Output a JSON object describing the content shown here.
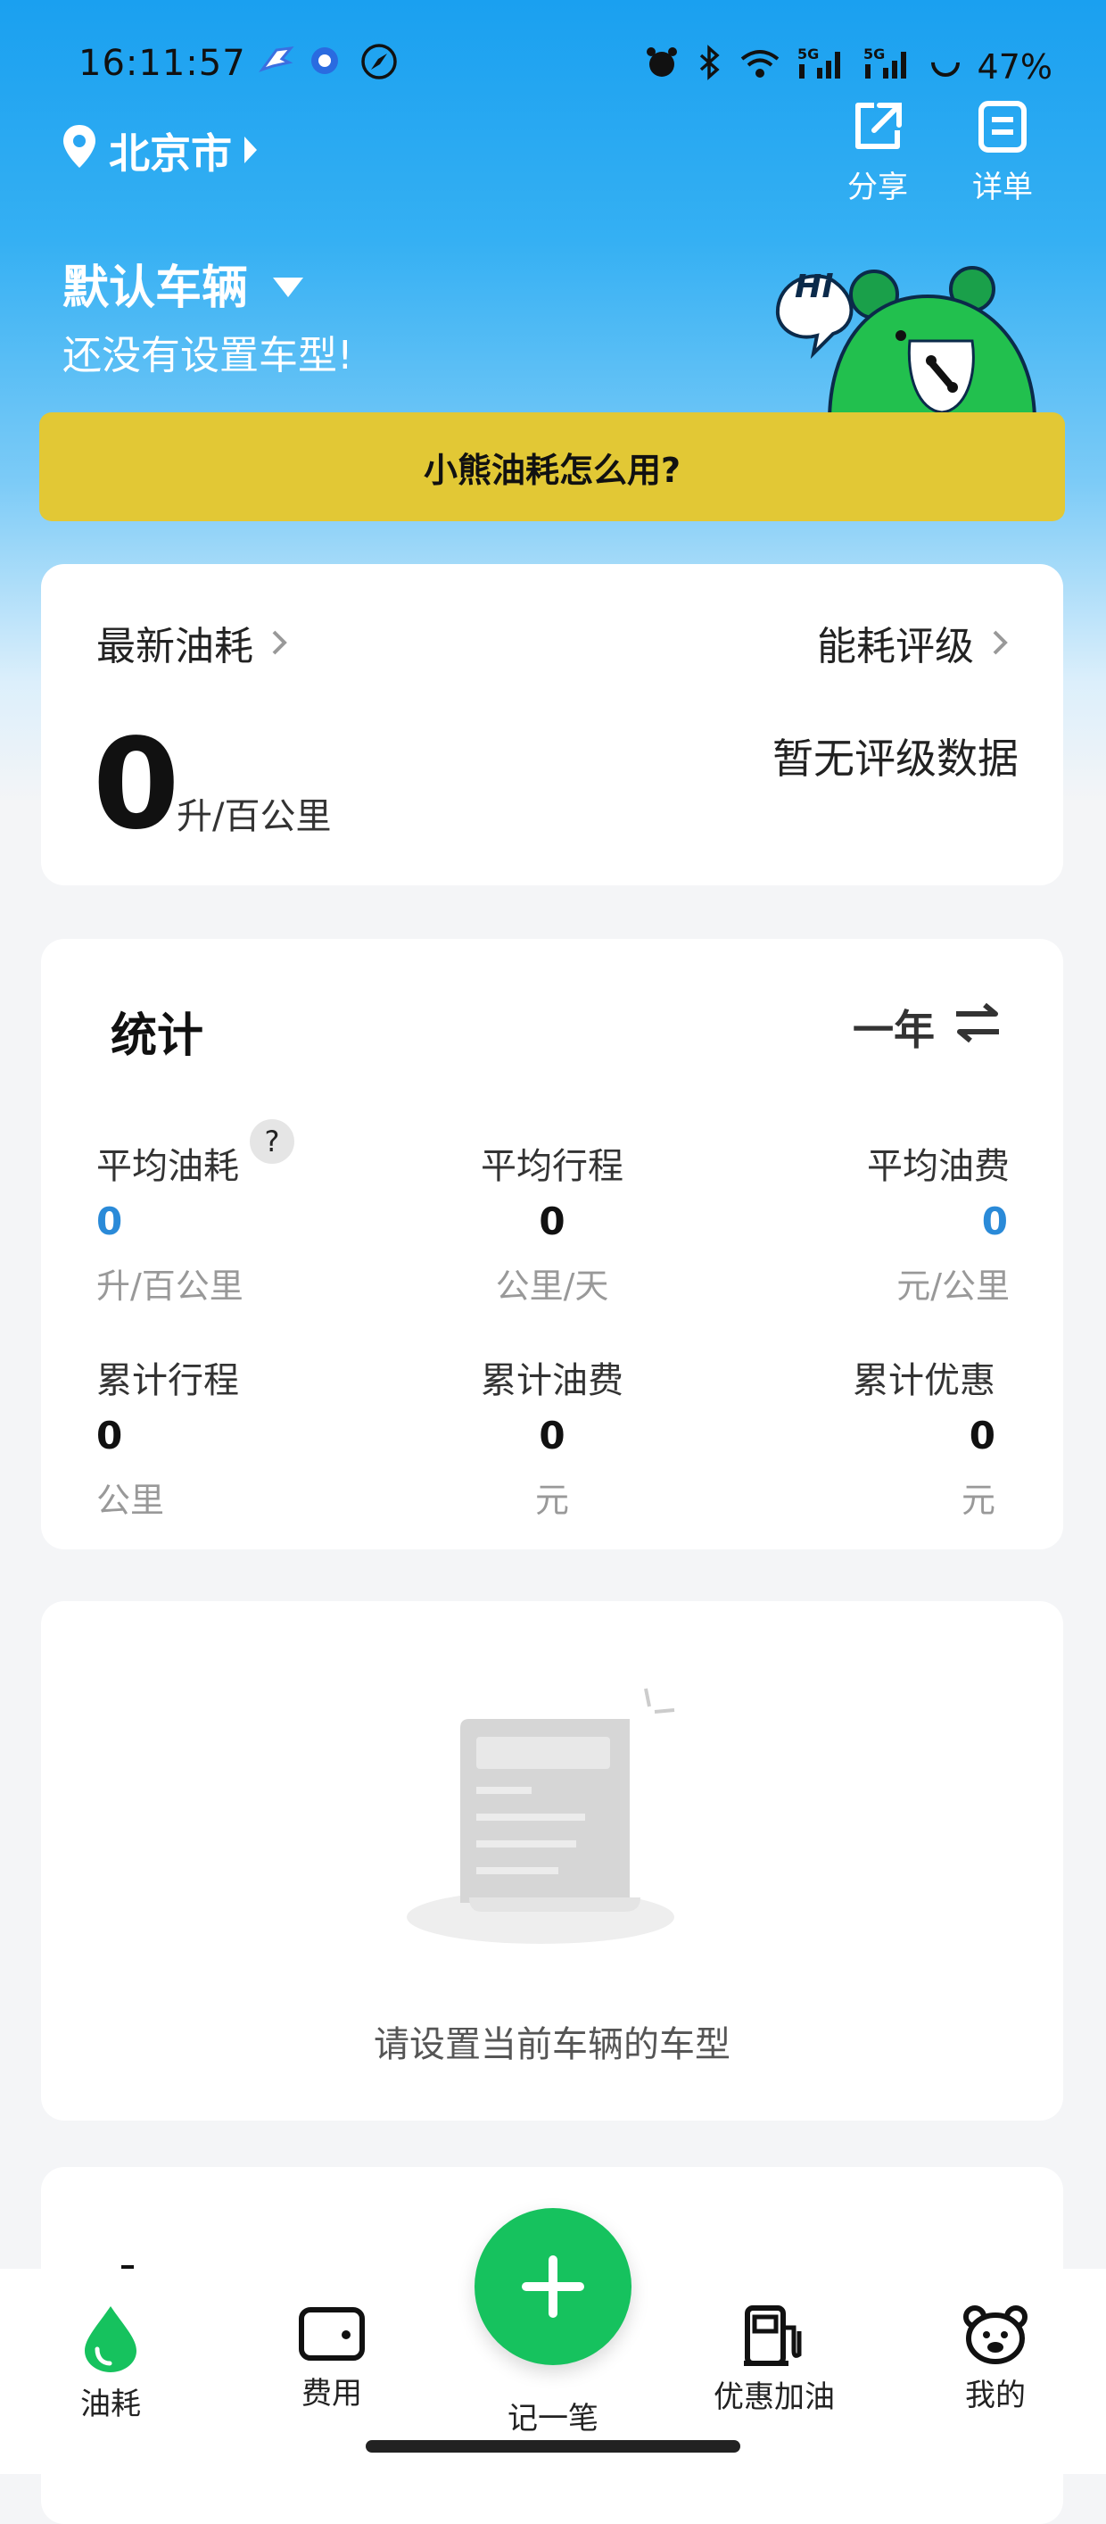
{
  "status_bar": {
    "time": "16:11:57",
    "battery": "47%",
    "icons": [
      "bird-icon",
      "record-icon",
      "compass-icon",
      "alarm-icon",
      "bluetooth-icon",
      "wifi-icon",
      "signal-5g-icon",
      "signal-5g-icon",
      "battery-icon"
    ]
  },
  "header": {
    "city": "北京市",
    "share_label": "分享",
    "detail_label": "详单",
    "vehicle_name": "默认车辆",
    "vehicle_subtitle": "还没有设置车型!",
    "mascot_bubble": "Hi",
    "howto_label": "小熊油耗怎么用?"
  },
  "latest": {
    "latest_label": "最新油耗",
    "rating_label": "能耗评级",
    "value": "0",
    "unit": "升/百公里",
    "rating_value": "暂无评级数据"
  },
  "stats": {
    "title": "统计",
    "period": "一年",
    "items": [
      {
        "label": "平均油耗",
        "value": "0",
        "unit": "升/百公里"
      },
      {
        "label": "平均行程",
        "value": "0",
        "unit": "公里/天"
      },
      {
        "label": "平均油费",
        "value": "0",
        "unit": "元/公里"
      },
      {
        "label": "累计行程",
        "value": "0",
        "unit": "公里"
      },
      {
        "label": "累计油费",
        "value": "0",
        "unit": "元"
      },
      {
        "label": "累计优惠",
        "value": "0",
        "unit": "元"
      }
    ],
    "help_mark": "?"
  },
  "empty_state": {
    "text": "请设置当前车辆的车型"
  },
  "tabs": {
    "fuel": "油耗",
    "expense": "费用",
    "record": "记一笔",
    "gas": "优惠加油",
    "mine": "我的"
  },
  "colors": {
    "brand_green": "#16c25e",
    "howto_yellow": "#e2c835",
    "value_blue": "#2a8ad8",
    "sky_blue": "#1aa0f0"
  }
}
